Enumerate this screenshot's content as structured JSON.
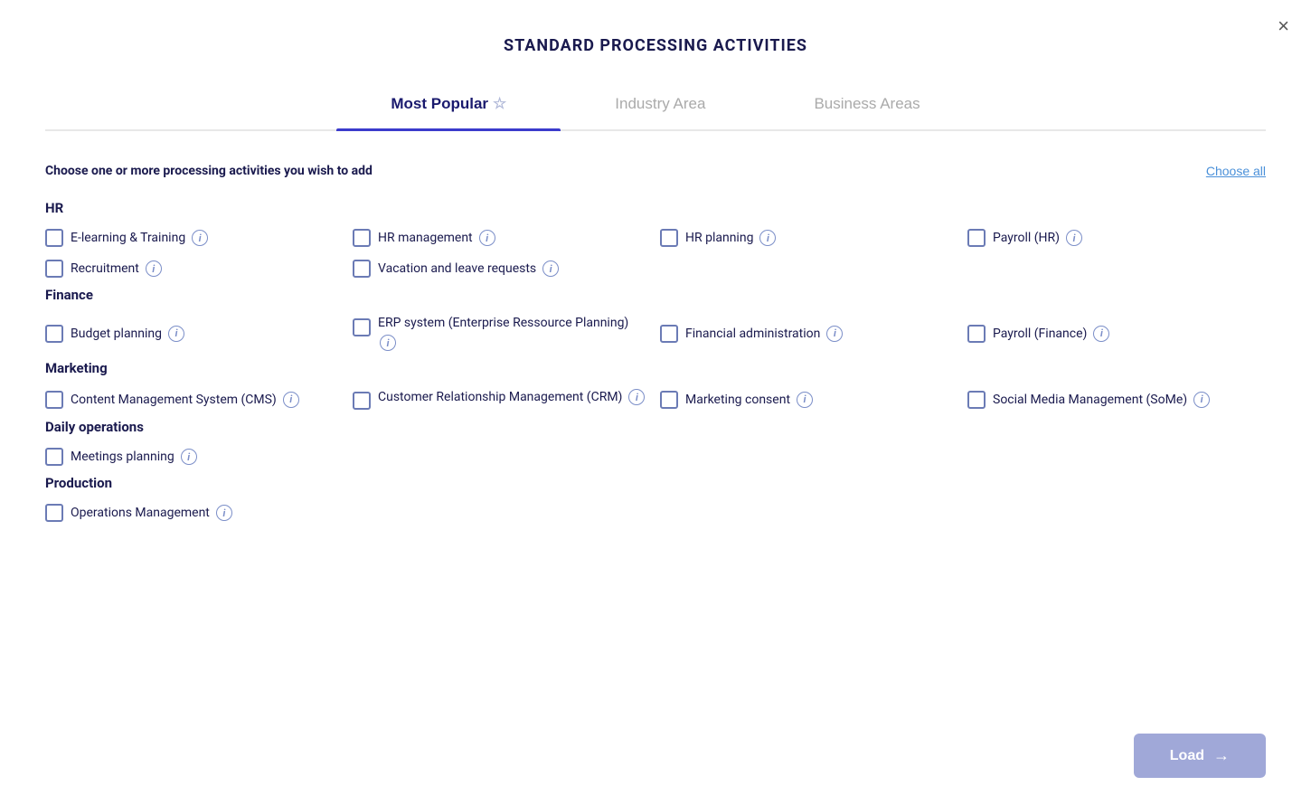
{
  "modal": {
    "title": "STANDARD PROCESSING ACTIVITIES",
    "close_label": "×"
  },
  "tabs": [
    {
      "id": "most-popular",
      "label": "Most Popular",
      "star": "☆",
      "active": true
    },
    {
      "id": "industry-area",
      "label": "Industry Area",
      "active": false
    },
    {
      "id": "business-areas",
      "label": "Business Areas",
      "active": false
    }
  ],
  "content": {
    "instruction": "Choose one or more processing activities you wish to add",
    "choose_all": "Choose all"
  },
  "sections": [
    {
      "id": "hr",
      "title": "HR",
      "items": [
        {
          "id": "elearning",
          "label": "E-learning & Training"
        },
        {
          "id": "hr-mgmt",
          "label": "HR management"
        },
        {
          "id": "hr-planning",
          "label": "HR planning"
        },
        {
          "id": "payroll-hr",
          "label": "Payroll (HR)"
        },
        {
          "id": "recruitment",
          "label": "Recruitment"
        },
        {
          "id": "vacation",
          "label": "Vacation and leave requests"
        }
      ]
    },
    {
      "id": "finance",
      "title": "Finance",
      "items": [
        {
          "id": "budget",
          "label": "Budget planning"
        },
        {
          "id": "erp",
          "label": "ERP system (Enterprise Ressource Planning)"
        },
        {
          "id": "financial-admin",
          "label": "Financial administration"
        },
        {
          "id": "payroll-fin",
          "label": "Payroll (Finance)"
        }
      ]
    },
    {
      "id": "marketing",
      "title": "Marketing",
      "items": [
        {
          "id": "cms",
          "label": "Content Management System (CMS)"
        },
        {
          "id": "crm",
          "label": "Customer Relationship Management (CRM)"
        },
        {
          "id": "mkt-consent",
          "label": "Marketing consent"
        },
        {
          "id": "social-media",
          "label": "Social Media Management (SoMe)"
        }
      ]
    },
    {
      "id": "daily-ops",
      "title": "Daily operations",
      "items": [
        {
          "id": "meetings",
          "label": "Meetings planning"
        }
      ]
    },
    {
      "id": "production",
      "title": "Production",
      "items": [
        {
          "id": "ops-mgmt",
          "label": "Operations Management"
        }
      ]
    }
  ],
  "footer": {
    "load_label": "Load",
    "arrow": "→"
  }
}
